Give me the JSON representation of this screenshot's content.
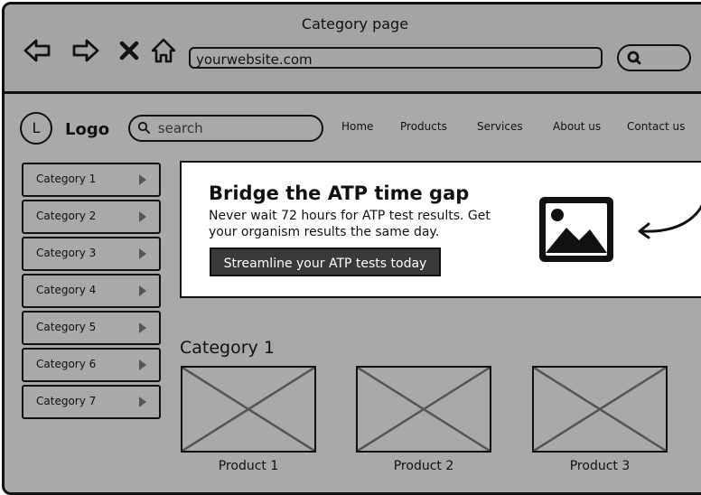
{
  "window": {
    "title": "Category page"
  },
  "browser": {
    "url": "yourwebsite.com",
    "nav_icons": [
      "back-arrow-icon",
      "forward-arrow-icon",
      "close-icon",
      "home-icon",
      "search-icon"
    ]
  },
  "header": {
    "logo_letter": "L",
    "logo_text": "Logo",
    "search_placeholder": "search",
    "nav": [
      "Home",
      "Products",
      "Services",
      "About us",
      "Contact us"
    ]
  },
  "sidebar": {
    "categories": [
      "Category 1",
      "Category 2",
      "Category 3",
      "Category 4",
      "Category 5",
      "Category 6",
      "Category 7"
    ]
  },
  "banner": {
    "title": "Bridge the ATP time gap",
    "text": "Never wait 72 hours for ATP test results. Get your organism results the same day.",
    "cta": "Streamline your ATP tests today"
  },
  "section": {
    "title": "Category 1",
    "products": [
      "Product 1",
      "Product 2",
      "Product 3"
    ]
  },
  "colors": {
    "chrome": "#a4a4a4",
    "page": "#a9a9a9",
    "cta": "#3a3a3a"
  }
}
